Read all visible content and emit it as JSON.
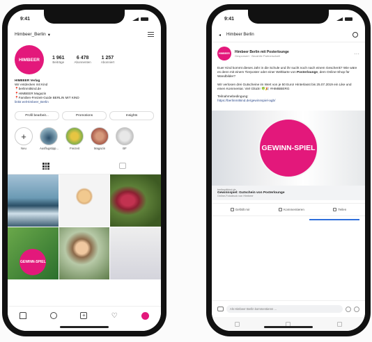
{
  "status": {
    "time": "9:41"
  },
  "instagram": {
    "username": "Himbeer_Berlin",
    "dropdown_glyph": "▾",
    "avatar_text": "HIMBEER",
    "stats": [
      {
        "value": "1 961",
        "label": "Beiträge"
      },
      {
        "value": "6 478",
        "label": "Abonnenten"
      },
      {
        "value": "1 257",
        "label": "Abonniert"
      }
    ],
    "bio": {
      "name": "HIMBEER Verlag",
      "line1": "Wir entdecken mit Kind",
      "line2": "📍berlinmitkind.de",
      "line3": "📍HIMBEER Magazin",
      "line4": "📍Familien-Freizeit-Guide BERLIN MIT KIND",
      "link": "linktr.ee/Himbeer_Berlin"
    },
    "buttons": [
      "Profil bearbeit...",
      "Promotions",
      "Insights"
    ],
    "highlights": [
      {
        "label": "Neu",
        "glyph": "+"
      },
      {
        "label": "Ausflugstipp..."
      },
      {
        "label": "Freizeit"
      },
      {
        "label": "Magazin"
      },
      {
        "label": "BF"
      }
    ],
    "grid_post_text": "GEWINN-SPIEL"
  },
  "facebook": {
    "back_glyph": "◂",
    "page_title": "Himbeer Berlin",
    "post_author": "Himbeer Berlin mit Posterlounge",
    "post_meta": "Gesponsert · Bezahlte Partnerschaft",
    "avatar_text": "HIMBEER",
    "more_glyph": "···",
    "text_p1": "Euer Kind kommt dieses Jahr in die Schule und ihr sucht noch nach einem Geschenk? Wie wäre es denn mit einem Tierposter oder einer Weltkarte von",
    "text_p1_brand": "Posterlounge",
    "text_p1_end": ", dem Online-Shop für Wandbilder?",
    "text_p2": "Wir verlosen drei Gutscheine im Wert von je 50 Euro! Hinterlasst bis 25.07.2019 ein Like und einen Kommentar. Viel Glück! 🍀🎉 #HIMBBERG",
    "text_p3": "Teilnahmebedingung:",
    "text_p3_link": "https://berlinmitkind.de/gewinnspiel-agb/",
    "image_text": "GEWINN-SPIEL",
    "link_host": "berlinmitkind.de",
    "link_title": "Gewinnspiel: Gutschein von Posterlounge",
    "link_sub": "Online-Fotodruck von Himbeer",
    "actions": [
      "Gefällt mir",
      "Kommentieren",
      "Teilen"
    ],
    "comment_placeholder": "Als Himbeer Berlin kommentieren ..."
  }
}
